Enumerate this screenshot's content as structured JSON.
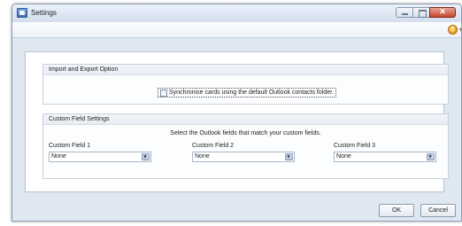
{
  "window": {
    "title": "Settings"
  },
  "import_export": {
    "header": "Import and Export Option",
    "sync_label": "Synchronise cards using the default Outlook contacts folder.",
    "sync_checked": false
  },
  "custom_fields": {
    "header": "Custom Field Settings",
    "instruction": "Select the Outlook fields that match your custom fields.",
    "fields": [
      {
        "label": "Custom Field 1",
        "value": "None"
      },
      {
        "label": "Custom Field 2",
        "value": "None"
      },
      {
        "label": "Custom Field 3",
        "value": "None"
      }
    ]
  },
  "buttons": {
    "ok": "OK",
    "cancel": "Cancel"
  },
  "icons": {
    "help": "help-icon",
    "app": "settings-app-icon"
  },
  "colors": {
    "close_button": "#c8432a",
    "window_frame": "#dfe7f1"
  }
}
